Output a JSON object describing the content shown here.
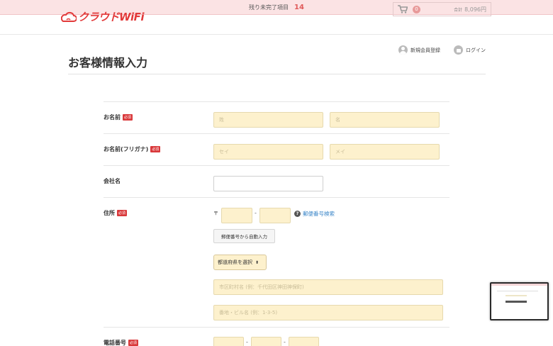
{
  "notice": {
    "text": "残り未完了項目",
    "count": "14"
  },
  "header": {
    "logo_text": "クラウドWiFi",
    "cart_count": "0",
    "cart_total_label": "合計",
    "cart_total": "8,096円"
  },
  "account": {
    "register": "新規会員登録",
    "login": "ログイン"
  },
  "page_title": "お客様情報入力",
  "required_badge": "必須",
  "form": {
    "name": {
      "label": "お名前",
      "last_placeholder": "姓",
      "first_placeholder": "名"
    },
    "kana": {
      "label": "お名前(フリガナ)",
      "last_placeholder": "セイ",
      "first_placeholder": "メイ"
    },
    "company": {
      "label": "会社名"
    },
    "address": {
      "label": "住所",
      "zip_mark": "〒",
      "zip_separator": "-",
      "zip_help": "郵便番号検索",
      "auto_button": "郵便番号から自動入力",
      "pref_select": "都道府県を選択",
      "city_placeholder": "市区町村名 (例：千代田区神田神保町)",
      "street_placeholder": "番地・ビル名 (例：1-3-5)"
    },
    "phone": {
      "label": "電話番号",
      "separator": "-"
    }
  },
  "colors": {
    "accent": "#e23a3a",
    "field_bg": "#fdf1cd",
    "required": "#d9383a",
    "link": "#3a86c8"
  }
}
